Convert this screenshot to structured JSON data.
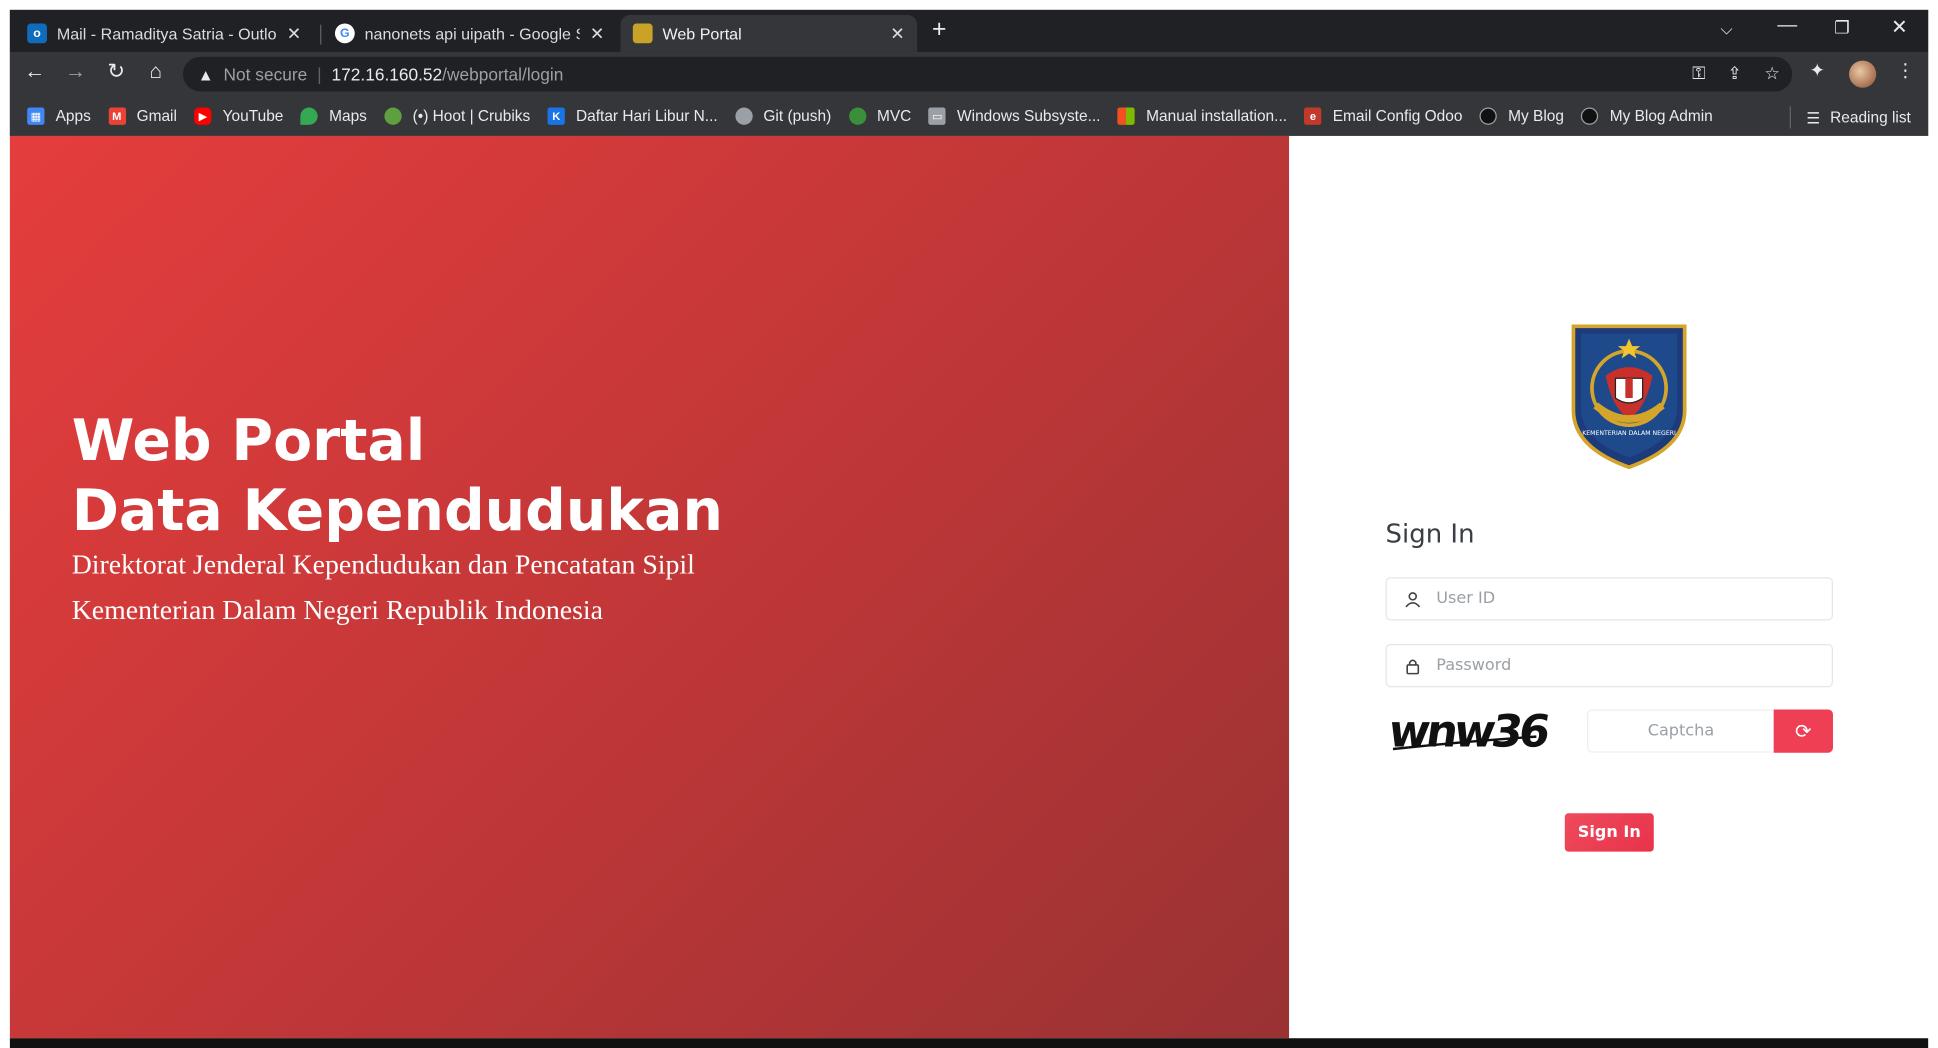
{
  "browser": {
    "tabs": [
      {
        "title": "Mail - Ramaditya Satria - Outlook",
        "favicon": "outlook-icon",
        "color": "#0f6cbd"
      },
      {
        "title": "nanonets api uipath - Google Search",
        "favicon": "google-icon",
        "color": "#ffffff"
      },
      {
        "title": "Web Portal",
        "favicon": "web-portal-icon",
        "color": "#c9a227",
        "active": true
      }
    ],
    "url": {
      "security": "Not secure",
      "host": "172.16.160.52",
      "path": "/webportal/login"
    },
    "bookmarks": [
      {
        "label": "Apps",
        "icon": "apps-grid-icon",
        "color": "#4285f4"
      },
      {
        "label": "Gmail",
        "icon": "gmail-icon",
        "color": "#ea4335"
      },
      {
        "label": "YouTube",
        "icon": "youtube-icon",
        "color": "#ff0000"
      },
      {
        "label": "Maps",
        "icon": "maps-pin-icon",
        "color": "#34a853"
      },
      {
        "label": "(•) Hoot | Crubiks",
        "icon": "hoot-icon",
        "color": "#5f9f3f"
      },
      {
        "label": "Daftar Hari Libur N...",
        "icon": "kalender-icon",
        "color": "#1a73e8"
      },
      {
        "label": "Git (push)",
        "icon": "globe-icon",
        "color": "#9aa0a6"
      },
      {
        "label": "MVC",
        "icon": "mvc-icon",
        "color": "#3a8f3a"
      },
      {
        "label": "Windows Subsyste...",
        "icon": "monitor-icon",
        "color": "#9aa0a6"
      },
      {
        "label": "Manual installation...",
        "icon": "microsoft-icon",
        "color": "#f25022"
      },
      {
        "label": "Email Config Odoo",
        "icon": "odoo-icon",
        "color": "#c0392b"
      },
      {
        "label": "My Blog",
        "icon": "blog-icon",
        "color": "#202124"
      },
      {
        "label": "My Blog Admin",
        "icon": "blog-admin-icon",
        "color": "#202124"
      }
    ],
    "reading_list": "Reading list"
  },
  "hero": {
    "title_line1": "Web Portal",
    "title_line2": "Data Kependudukan",
    "subtitle_line1": "Direktorat Jenderal Kependudukan dan Pencatatan Sipil",
    "subtitle_line2": "Kementerian Dalam Negeri Republik Indonesia",
    "gradient_start": "#e53d3d",
    "gradient_end": "#993233"
  },
  "login": {
    "emblem_text": "KEMENTERIAN DALAM NEGERI",
    "heading": "Sign In",
    "user_placeholder": "User ID",
    "password_placeholder": "Password",
    "captcha_text": "wnw36",
    "captcha_placeholder": "Captcha",
    "submit_label": "Sign In",
    "accent_color": "#ee3f55"
  }
}
